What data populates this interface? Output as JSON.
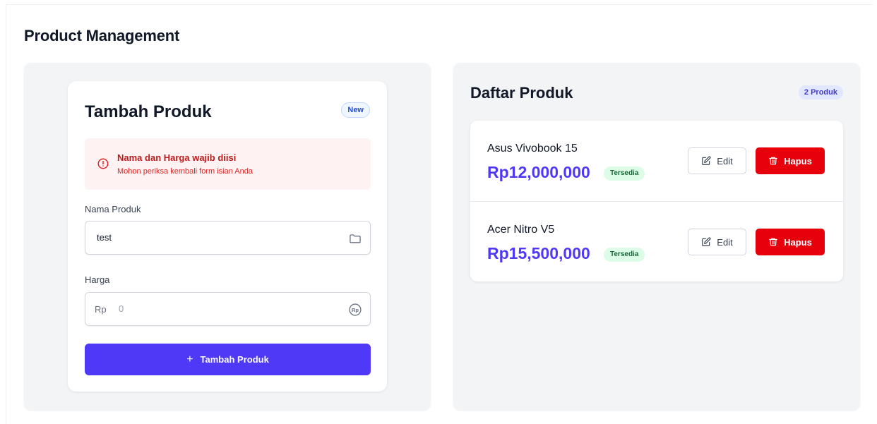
{
  "page": {
    "title": "Product Management"
  },
  "form": {
    "title": "Tambah Produk",
    "badge": "New",
    "alert": {
      "title": "Nama dan Harga wajib diisi",
      "message": "Mohon periksa kembali form isian Anda",
      "icon": "alert-circle-icon"
    },
    "name_field": {
      "label": "Nama Produk",
      "value": "test",
      "icon": "folder-icon"
    },
    "price_field": {
      "label": "Harga",
      "prefix": "Rp",
      "value": "",
      "placeholder": "0",
      "icon": "rupiah-coin-icon"
    },
    "submit": {
      "icon": "+",
      "label": "Tambah Produk"
    }
  },
  "list": {
    "title": "Daftar Produk",
    "count_badge": "2 Produk",
    "items": [
      {
        "name": "Asus Vivobook 15",
        "price": "Rp12,000,000",
        "status": "Tersedia",
        "edit_label": "Edit",
        "delete_label": "Hapus"
      },
      {
        "name": "Acer Nitro V5",
        "price": "Rp15,500,000",
        "status": "Tersedia",
        "edit_label": "Edit",
        "delete_label": "Hapus"
      }
    ]
  },
  "colors": {
    "primary": "#4f39f6",
    "danger": "#e7000b",
    "alert_bg": "#fef2f2",
    "alert_text": "#b91c1c",
    "success_bg": "#dcfce7",
    "success_text": "#166534"
  }
}
